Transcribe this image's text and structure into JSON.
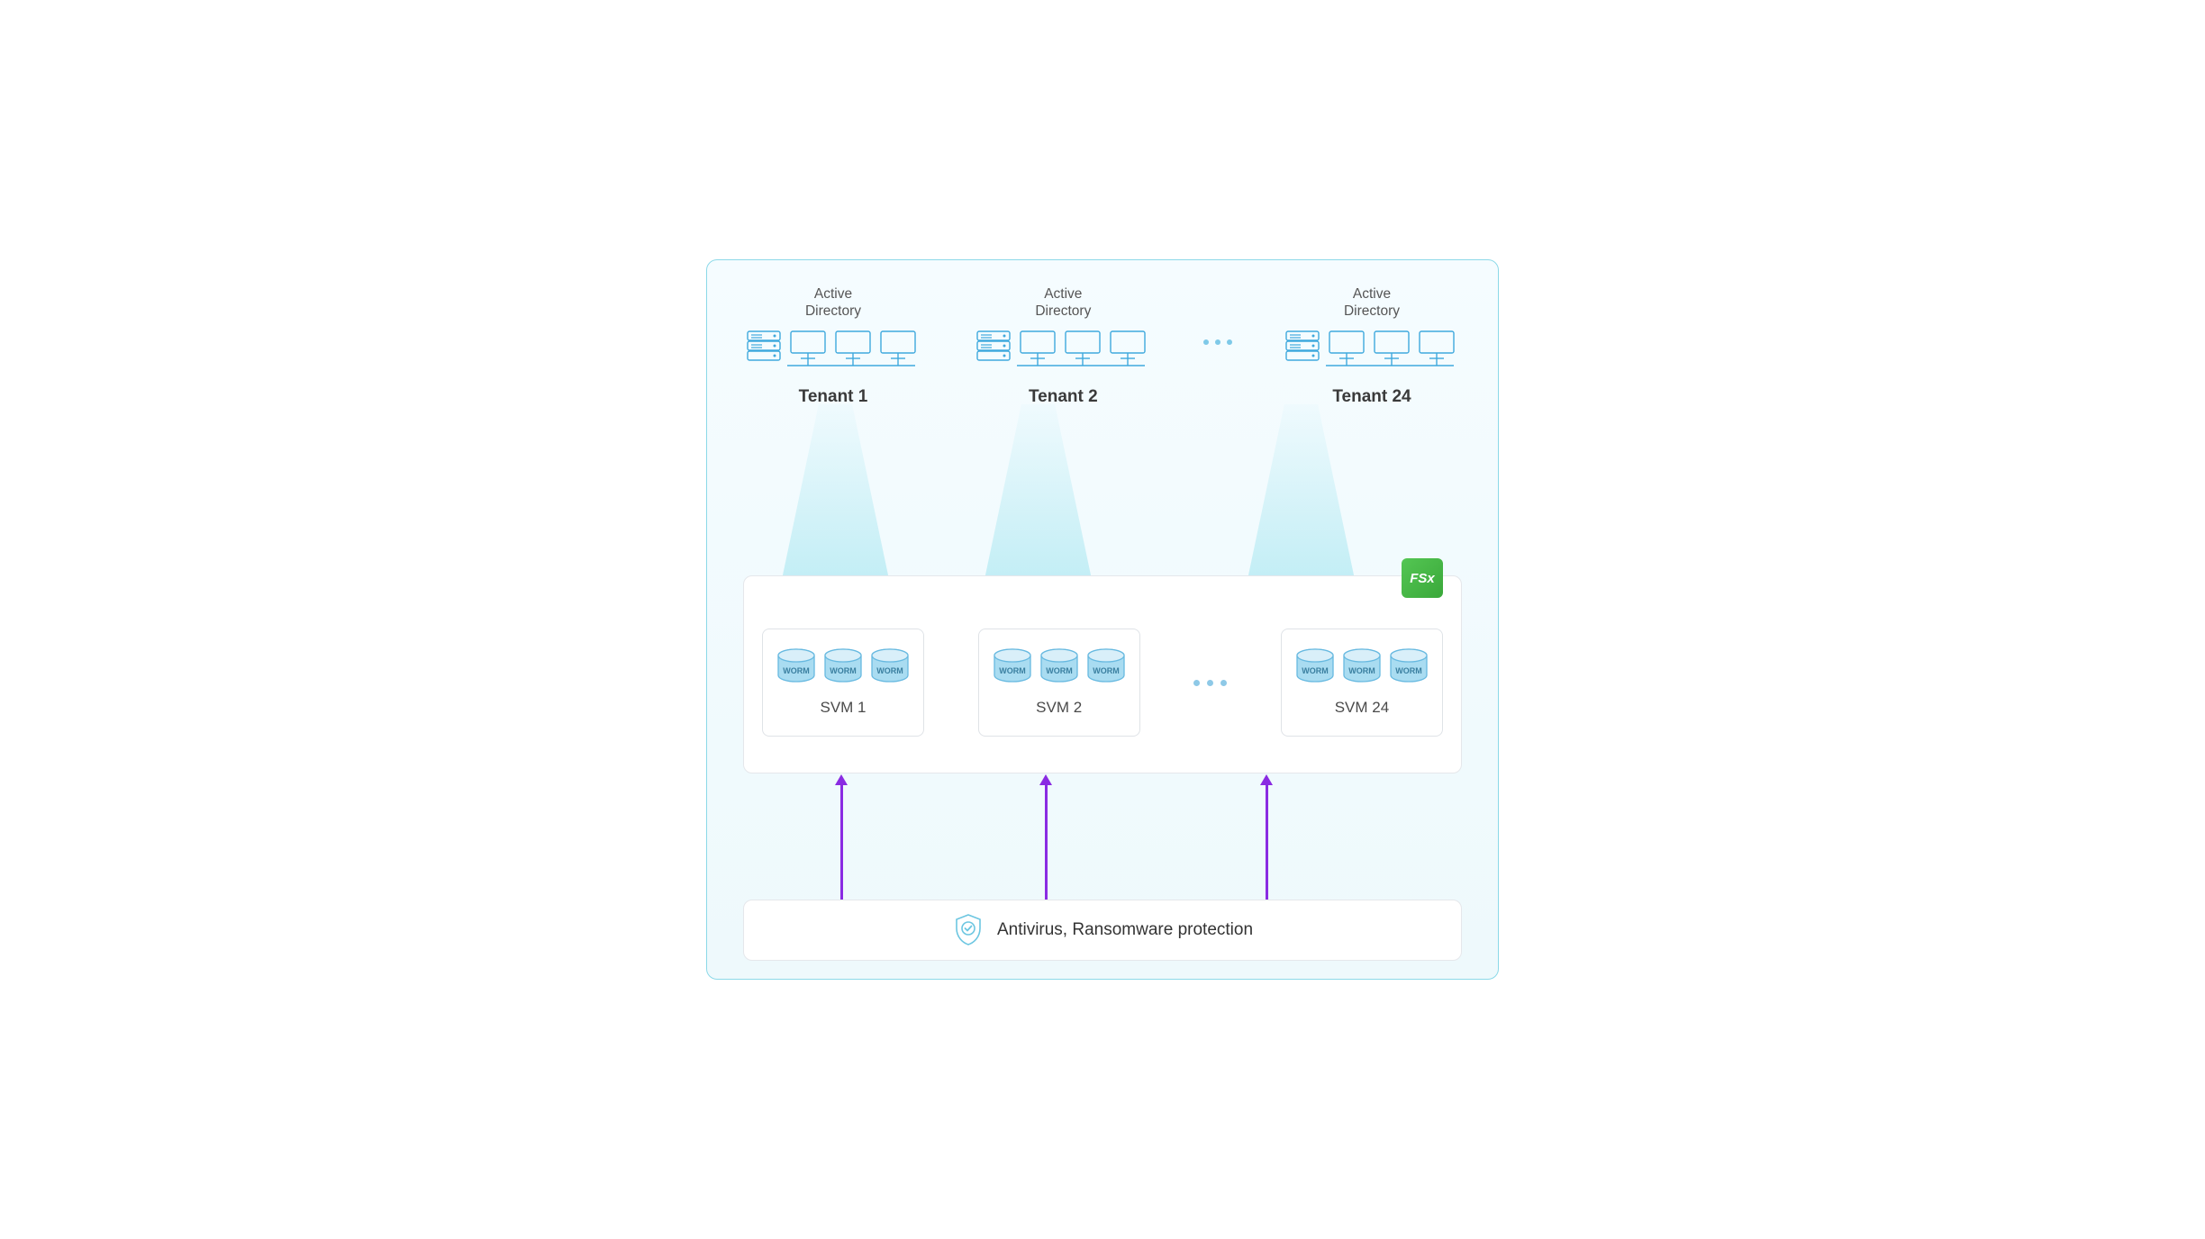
{
  "ad_label": "Active\nDirectory",
  "tenants": [
    {
      "label": "Tenant 1"
    },
    {
      "label": "Tenant 2"
    },
    {
      "label": "Tenant 24"
    }
  ],
  "svms": [
    {
      "label": "SVM 1",
      "barrels": [
        "WORM",
        "WORM",
        "WORM"
      ]
    },
    {
      "label": "SVM 2",
      "barrels": [
        "WORM",
        "WORM",
        "WORM"
      ]
    },
    {
      "label": "SVM 24",
      "barrels": [
        "WORM",
        "WORM",
        "WORM"
      ]
    }
  ],
  "fsx_badge": "FSx",
  "protection_label": "Antivirus, Ransomware protection",
  "colors": {
    "stroke": "#3fa9dd",
    "light": "#bde6f5",
    "accent_purple": "#8a2be2",
    "fsx_green": "#3aa83a"
  }
}
